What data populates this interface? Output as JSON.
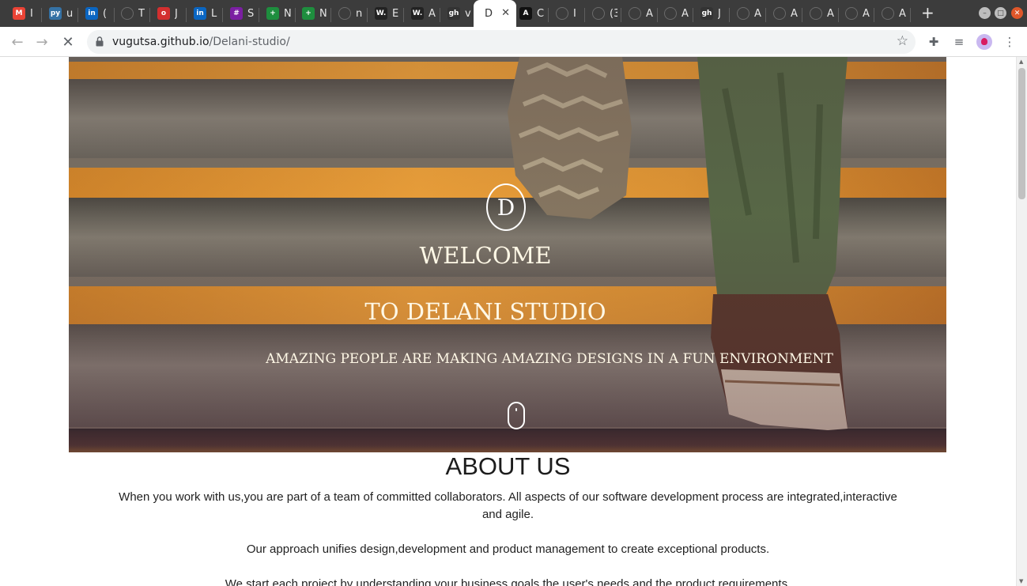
{
  "browser": {
    "tabs": [
      {
        "favicon": "M",
        "color": "#ea4335",
        "text": "I"
      },
      {
        "favicon": "py",
        "color": "#3572a5",
        "text": "u"
      },
      {
        "favicon": "in",
        "color": "#0a66c2",
        "text": "("
      },
      {
        "favicon": "",
        "color": "#2e7d32",
        "text": "T"
      },
      {
        "favicon": "o",
        "color": "#d32f2f",
        "text": "J"
      },
      {
        "favicon": "in",
        "color": "#0a66c2",
        "text": "L"
      },
      {
        "favicon": "#",
        "color": "#7b1fa2",
        "text": "S"
      },
      {
        "favicon": "+",
        "color": "#1e8e3e",
        "text": "N"
      },
      {
        "favicon": "+",
        "color": "#1e8e3e",
        "text": "N"
      },
      {
        "favicon": "",
        "color": "#2e7d32",
        "text": "n"
      },
      {
        "favicon": "W.",
        "color": "#222222",
        "text": "E"
      },
      {
        "favicon": "W.",
        "color": "#222222",
        "text": "A"
      },
      {
        "favicon": "gh",
        "color": "#333333",
        "text": "v"
      },
      {
        "favicon": "",
        "color": "#ffffff",
        "text": "D",
        "active": true
      },
      {
        "favicon": "A",
        "color": "#111111",
        "text": "C"
      },
      {
        "favicon": "",
        "color": "#444444",
        "text": "I"
      },
      {
        "favicon": "",
        "color": "#444444",
        "text": "(3"
      },
      {
        "favicon": "",
        "color": "#444444",
        "text": "A"
      },
      {
        "favicon": "",
        "color": "#444444",
        "text": "A"
      },
      {
        "favicon": "gh",
        "color": "#333333",
        "text": "J"
      },
      {
        "favicon": "",
        "color": "#444444",
        "text": "A"
      },
      {
        "favicon": "",
        "color": "#444444",
        "text": "A"
      },
      {
        "favicon": "",
        "color": "#444444",
        "text": "A"
      },
      {
        "favicon": "",
        "color": "#444444",
        "text": "A"
      },
      {
        "favicon": "",
        "color": "#444444",
        "text": "A"
      }
    ],
    "active_tab_close": "✕",
    "new_tab": "+",
    "url_host": "vugutsa.github.io",
    "url_path": "/Delani-studio/",
    "back_icon": "←",
    "forward_icon": "→",
    "reload_icon": "✕",
    "star_icon": "☆",
    "extensions_icon": "✚",
    "media_icon": "≡",
    "menu_icon": "⋮"
  },
  "hero": {
    "logo_letter": "D",
    "title_line1": "WELCOME",
    "title_line2": "TO DELANI STUDIO",
    "tagline": "AMAZING PEOPLE ARE MAKING AMAZING DESIGNS IN A FUN ENVIRONMENT"
  },
  "about": {
    "title": "ABOUT US",
    "paragraph1": "When you work with us,you are part of a team of committed collaborators. All aspects of our software development process are integrated,interactive and agile.",
    "paragraph2": "Our approach unifies design,development and product management to create exceptional products.",
    "paragraph3": "We start each project by understanding your business goals,the user's needs and the product requirements."
  },
  "colors": {
    "accent_orange": "#f3a53a",
    "tabstrip": "#3c3c3c"
  }
}
